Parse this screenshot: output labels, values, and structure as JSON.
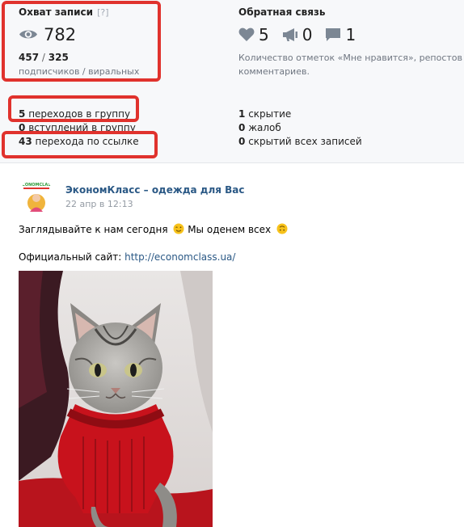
{
  "reach": {
    "title": "Охват записи",
    "help": "[?]",
    "views": "782",
    "subscribers": "457",
    "viral": "325",
    "ratio_sep": "/",
    "caption": "подписчиков / виральных"
  },
  "feedback": {
    "title": "Обратная связь",
    "likes": "5",
    "reposts": "0",
    "comments": "1",
    "caption_line1": "Количество отметок «Мне нравится», репостов и",
    "caption_line2": "комментариев."
  },
  "actions": {
    "group_transitions_num": "5",
    "group_transitions_text": "переходов в группу",
    "group_joins_num": "0",
    "group_joins_text": "вступлений в группу",
    "link_clicks_num": "43",
    "link_clicks_text": "перехода по ссылке"
  },
  "negative": {
    "hides_num": "1",
    "hides_text": "скрытие",
    "reports_num": "0",
    "reports_text": "жалоб",
    "hide_all_num": "0",
    "hide_all_text": "скрытий всех записей"
  },
  "post": {
    "avatar_brand": "eCONOMCLASS",
    "group_name": "ЭкономКласс – одежда для Вас",
    "date": "22 апр в 12:13",
    "text_part1": "Заглядывайте к нам сегодня",
    "text_part2": "Мы оденем всех",
    "site_label": "Официальный сайт:",
    "site_url": "http://economclass.ua/"
  },
  "colors": {
    "highlight": "#e0322d",
    "link": "#2a5885",
    "icon": "#7c8794"
  },
  "icons": [
    "eye-icon",
    "heart-icon",
    "megaphone-icon",
    "comment-icon",
    "wink-emoji",
    "upside-down-face-emoji"
  ]
}
